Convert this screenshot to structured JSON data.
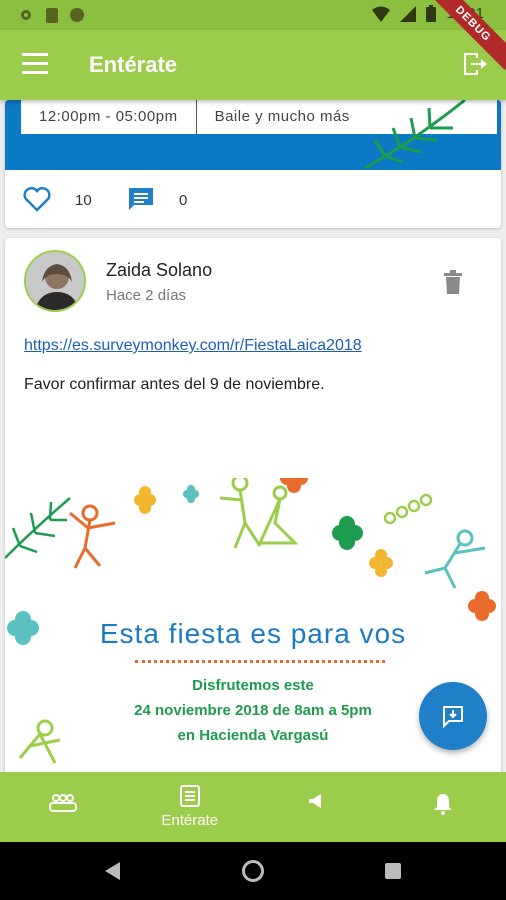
{
  "status_bar": {
    "time": "12:01"
  },
  "debug_banner": "DEBUG",
  "app_bar": {
    "title": "Entérate"
  },
  "previous_post": {
    "schedule_time": "12:00pm - 05:00pm",
    "schedule_activity": "Baile y mucho más",
    "likes": "10",
    "comments": "0"
  },
  "post": {
    "author": "Zaida Solano",
    "time_ago": "Hace 2 días",
    "link": "https://es.surveymonkey.com/r/FiestaLaica2018",
    "body": "Favor confirmar antes del 9 de noviembre.",
    "poster": {
      "title": "Esta fiesta es para vos",
      "line1": "Disfrutemos este",
      "line2": "24 noviembre 2018 de 8am a 5pm",
      "line3": "en Hacienda Vargasú"
    }
  },
  "bottom_nav": {
    "items": [
      {
        "icon": "people-group-icon",
        "label": ""
      },
      {
        "icon": "news-icon",
        "label": "Entérate"
      },
      {
        "icon": "megaphone-icon",
        "label": ""
      },
      {
        "icon": "bell-icon",
        "label": ""
      }
    ]
  },
  "colors": {
    "primary": "#9ccc4b",
    "status_bar": "#8cbf3f",
    "accent": "#1f7fc9",
    "poster_blue": "#1a7bc4",
    "poster_green": "#1d9b4f"
  }
}
